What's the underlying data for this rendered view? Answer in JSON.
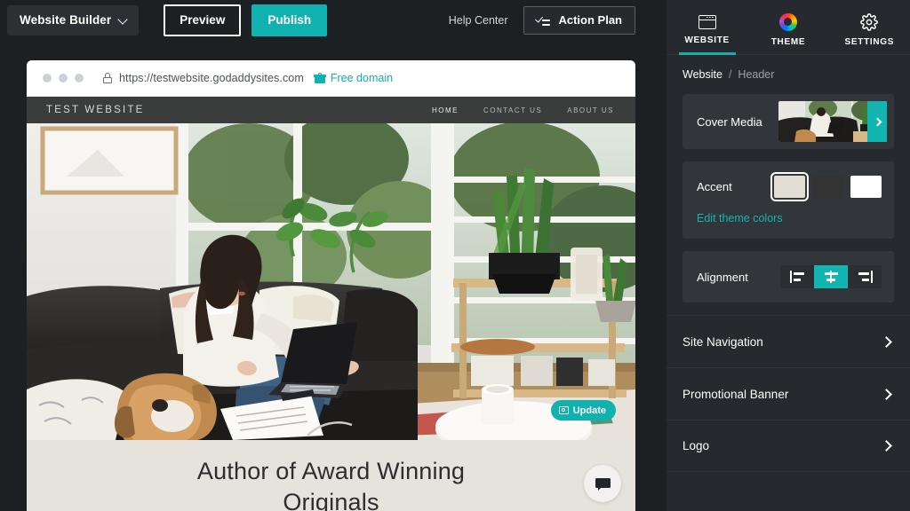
{
  "topbar": {
    "app_menu_label": "Website Builder",
    "app_menu_icon": "chevron-down-icon",
    "preview_label": "Preview",
    "publish_label": "Publish",
    "help_center_label": "Help Center",
    "action_plan_label": "Action Plan",
    "action_plan_icon": "checklist-icon",
    "publish_color": "#0fb2ae"
  },
  "browser": {
    "lock_icon": "lock-icon",
    "url": "https://testwebsite.godaddysites.com",
    "free_domain_label": "Free domain",
    "free_domain_icon": "gift-icon",
    "free_domain_color": "#0fb2ae"
  },
  "site": {
    "title": "TEST WEBSITE",
    "nav": [
      {
        "label": "HOME",
        "active": true
      },
      {
        "label": "CONTACT US",
        "active": false
      },
      {
        "label": "ABOUT US",
        "active": false
      }
    ],
    "header_bg": "#3b3d3c",
    "hero_alt": "woman working on laptop on black leather sofa with dog and plants",
    "update_label": "Update",
    "update_icon": "camera-icon",
    "heading": "Author of Award Winning Originals",
    "caption_bg": "#e6e3dd",
    "chat_icon": "chat-bubble-icon"
  },
  "sidebar": {
    "tabs": [
      {
        "label": "WEBSITE",
        "icon": "browser-window-icon",
        "active": true
      },
      {
        "label": "THEME",
        "icon": "color-wheel-icon",
        "active": false
      },
      {
        "label": "SETTINGS",
        "icon": "gear-icon",
        "active": false
      }
    ],
    "breadcrumb": {
      "root": "Website",
      "separator": "/",
      "current": "Header"
    },
    "cover_media": {
      "label": "Cover Media",
      "thumb_alt": "cover photo thumbnail",
      "chevron_icon": "chevron-right-icon"
    },
    "accent": {
      "label": "Accent",
      "swatches": [
        {
          "color": "#e3ded4",
          "selected": true
        },
        {
          "color": "#333333",
          "selected": false
        },
        {
          "color": "#ffffff",
          "selected": false
        }
      ],
      "edit_link": "Edit theme colors",
      "link_color": "#12b5b0"
    },
    "alignment": {
      "label": "Alignment",
      "options": [
        {
          "icon": "align-left-icon",
          "active": false
        },
        {
          "icon": "align-center-icon",
          "active": true
        },
        {
          "icon": "align-right-icon",
          "active": false
        }
      ],
      "active_color": "#12b5b0"
    },
    "rows": [
      {
        "label": "Site Navigation",
        "icon": "chevron-right-icon"
      },
      {
        "label": "Promotional Banner",
        "icon": "chevron-right-icon"
      },
      {
        "label": "Logo",
        "icon": "chevron-right-icon"
      }
    ]
  }
}
